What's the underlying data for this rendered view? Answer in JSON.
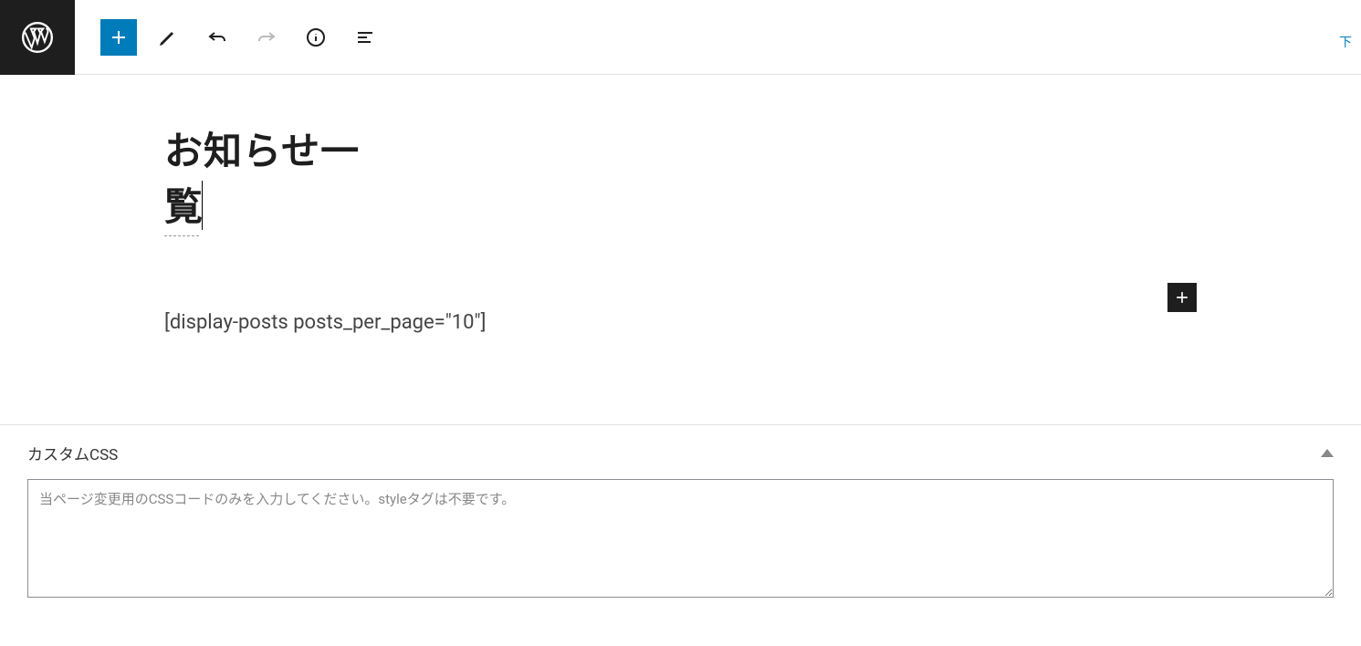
{
  "toolbar": {
    "add_block": "add",
    "pencil": "edit",
    "undo": "undo",
    "redo": "redo",
    "info": "info",
    "outline": "list-view"
  },
  "top_right_text": "下",
  "post": {
    "title": "お知らせ一覧",
    "body": "[display-posts posts_per_page=\"10\"]"
  },
  "custom_css": {
    "label": "カスタムCSS",
    "placeholder": "当ページ変更用のCSSコードのみを入力してください。styleタグは不要です。",
    "value": ""
  }
}
